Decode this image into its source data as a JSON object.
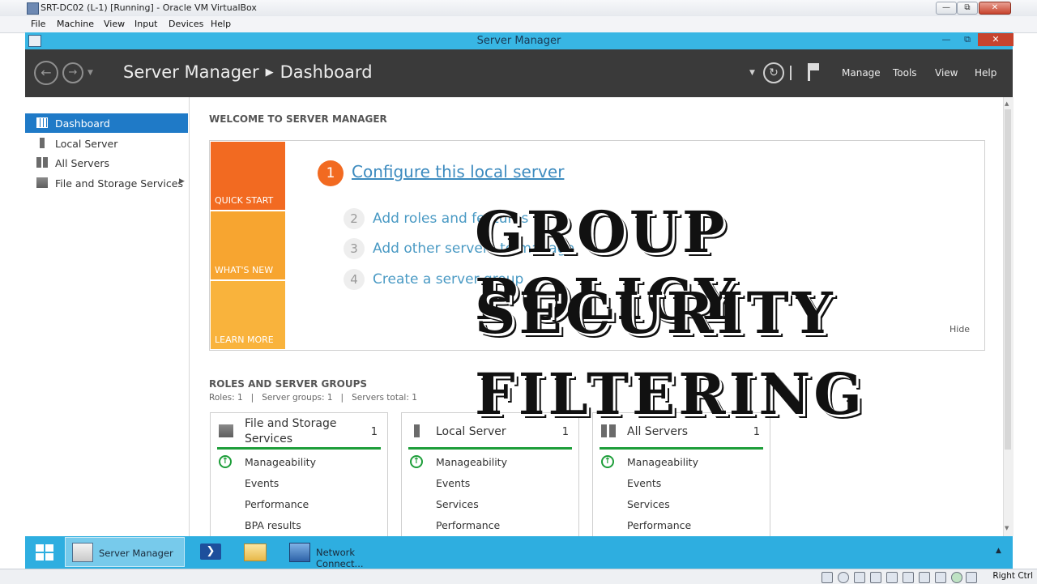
{
  "vbox": {
    "title": "SRT-DC02 (L-1) [Running] - Oracle VM VirtualBox",
    "menu": [
      "File",
      "Machine",
      "View",
      "Input",
      "Devices",
      "Help"
    ],
    "host_key": "Right Ctrl"
  },
  "window": {
    "title": "Server Manager"
  },
  "header": {
    "breadcrumb_root": "Server Manager",
    "breadcrumb_current": "Dashboard",
    "menu": [
      "Manage",
      "Tools",
      "View",
      "Help"
    ]
  },
  "sidebar": {
    "items": [
      {
        "label": "Dashboard",
        "icon": "dashboard-grid-icon",
        "active": true
      },
      {
        "label": "Local Server",
        "icon": "server-icon"
      },
      {
        "label": "All Servers",
        "icon": "servers-icon"
      },
      {
        "label": "File and Storage Services",
        "icon": "storage-icon",
        "expandable": true
      }
    ]
  },
  "welcome": {
    "heading": "WELCOME TO SERVER MANAGER",
    "tiles": [
      "QUICK START",
      "WHAT'S NEW",
      "LEARN MORE"
    ],
    "tile_colors": [
      "#f26a21",
      "#f7a530",
      "#f9b33c"
    ],
    "steps": [
      {
        "num": "1",
        "label": "Configure this local server"
      },
      {
        "num": "2",
        "label": "Add roles and features"
      },
      {
        "num": "3",
        "label": "Add other servers to manage"
      },
      {
        "num": "4",
        "label": "Create a server group"
      }
    ],
    "hide_label": "Hide"
  },
  "roles": {
    "heading": "ROLES AND SERVER GROUPS",
    "summary": "Roles: 1   |   Server groups: 1   |   Servers total: 1",
    "cards": [
      {
        "title": "File and Storage Services",
        "count": "1",
        "rows": [
          "Manageability",
          "Events",
          "Performance",
          "BPA results"
        ]
      },
      {
        "title": "Local Server",
        "count": "1",
        "rows": [
          "Manageability",
          "Events",
          "Services",
          "Performance"
        ]
      },
      {
        "title": "All Servers",
        "count": "1",
        "rows": [
          "Manageability",
          "Events",
          "Services",
          "Performance"
        ]
      }
    ]
  },
  "overlay": {
    "line1": "GROUP POLICY",
    "line2": "SECURITY",
    "line3": "FILTERING"
  },
  "taskbar": {
    "items": [
      {
        "label": "",
        "icon": "windows-start-icon"
      },
      {
        "label": "Server Manager",
        "icon": "server-manager-icon"
      },
      {
        "label": "",
        "icon": "powershell-icon"
      },
      {
        "label": "",
        "icon": "file-explorer-icon"
      },
      {
        "label": "Network Connect...",
        "icon": "network-connections-icon"
      }
    ]
  },
  "colors": {
    "accent": "#1f7ac7",
    "header_bg": "#3a3a3a",
    "taskbar": "#2eaee0",
    "quickstart": "#f26a21",
    "ok_green": "#1e9e3a"
  }
}
